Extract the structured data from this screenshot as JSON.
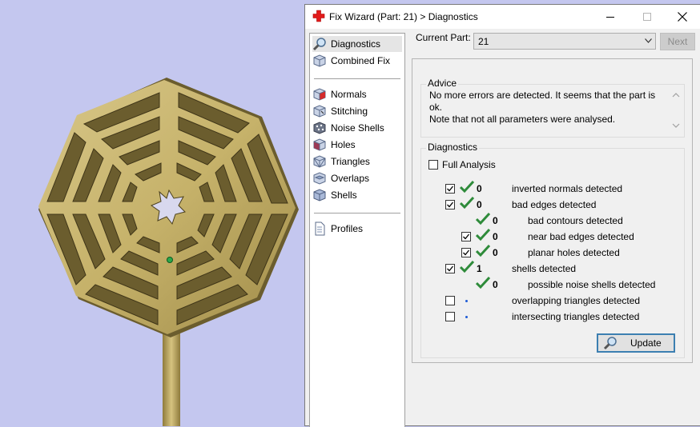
{
  "window": {
    "title": "Fix Wizard (Part: 21) > Diagnostics"
  },
  "sidebar": {
    "items": [
      {
        "label": "Diagnostics",
        "icon": "magnifier-icon"
      },
      {
        "label": "Combined Fix",
        "icon": "cube-icon"
      },
      {
        "label": "Normals",
        "icon": "normals-cube-icon"
      },
      {
        "label": "Stitching",
        "icon": "stitching-cube-icon"
      },
      {
        "label": "Noise Shells",
        "icon": "noise-shells-icon"
      },
      {
        "label": "Holes",
        "icon": "holes-cube-icon"
      },
      {
        "label": "Triangles",
        "icon": "triangles-cube-icon"
      },
      {
        "label": "Overlaps",
        "icon": "overlaps-cube-icon"
      },
      {
        "label": "Shells",
        "icon": "shells-cube-icon"
      },
      {
        "label": "Profiles",
        "icon": "profile-document-icon"
      }
    ]
  },
  "current_part": {
    "label": "Current Part:",
    "value": "21"
  },
  "next_button": "Next",
  "advice": {
    "title": "Advice",
    "line1": "No more errors are detected. It seems that the part is ok.",
    "line2": "Note that not all parameters were analysed."
  },
  "diagnostics": {
    "title": "Diagnostics",
    "full_analysis_label": "Full Analysis",
    "full_analysis_checked": false,
    "rows": [
      {
        "label": "inverted normals detected",
        "count": "0",
        "checked": true,
        "status": "ok",
        "indent": 0
      },
      {
        "label": "bad edges detected",
        "count": "0",
        "checked": true,
        "status": "ok",
        "indent": 0
      },
      {
        "label": "bad contours detected",
        "count": "0",
        "checked": null,
        "status": "ok",
        "indent": 1
      },
      {
        "label": "near bad edges detected",
        "count": "0",
        "checked": true,
        "status": "ok",
        "indent": 1
      },
      {
        "label": "planar holes detected",
        "count": "0",
        "checked": true,
        "status": "ok",
        "indent": 1
      },
      {
        "label": "shells detected",
        "count": "1",
        "checked": true,
        "status": "ok",
        "indent": 0
      },
      {
        "label": "possible noise shells detected",
        "count": "0",
        "checked": null,
        "status": "ok",
        "indent": 1
      },
      {
        "label": "overlapping triangles detected",
        "count": "",
        "checked": false,
        "status": "pending",
        "indent": 0
      },
      {
        "label": "intersecting triangles detected",
        "count": "",
        "checked": false,
        "status": "pending",
        "indent": 0
      }
    ],
    "update_button": "Update"
  },
  "colors": {
    "accent": "#3c7fb1",
    "check": "#2e8b3a",
    "part": "#c8b46a",
    "viewport": "#c4c7ef"
  }
}
